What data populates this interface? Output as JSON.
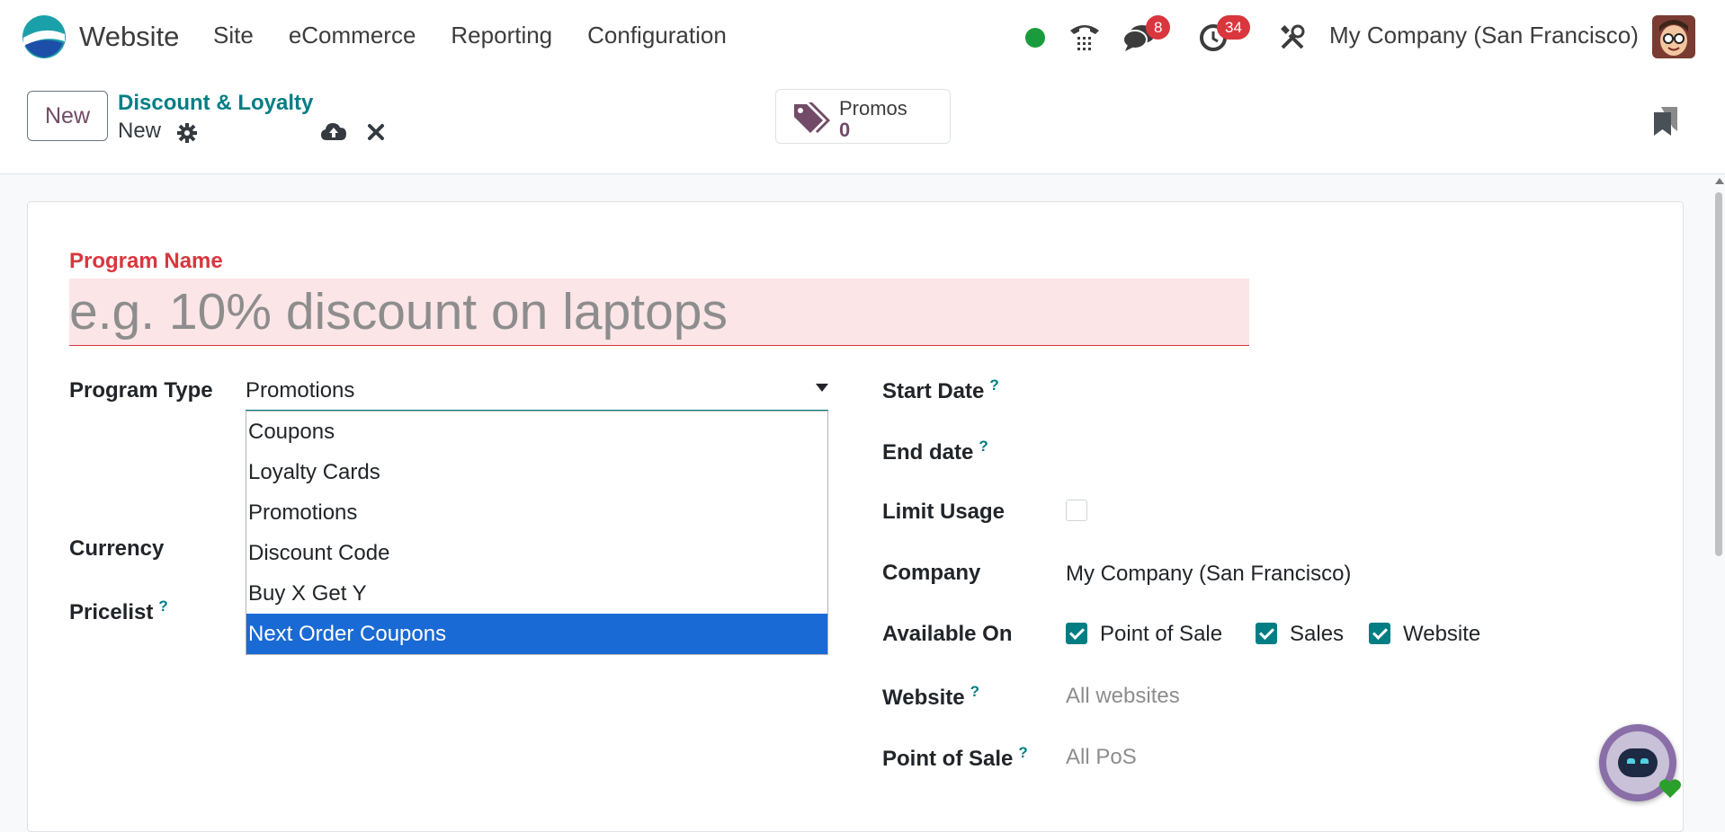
{
  "navbar": {
    "app_name": "Website",
    "menu": [
      "Site",
      "eCommerce",
      "Reporting",
      "Configuration"
    ],
    "messages_count": "8",
    "activities_count": "34",
    "company": "My Company (San Francisco)",
    "status_color": "#1a9c3e"
  },
  "control_panel": {
    "new_button": "New",
    "breadcrumb_parent": "Discount & Loyalty",
    "breadcrumb_current": "New",
    "stat_button": {
      "label": "Promos",
      "value": "0"
    }
  },
  "form": {
    "program_name_label": "Program Name",
    "program_name_placeholder": "e.g. 10% discount on laptops",
    "program_type_label": "Program Type",
    "program_type_value": "Promotions",
    "program_type_options": [
      "Coupons",
      "Loyalty Cards",
      "Promotions",
      "Discount Code",
      "Buy X Get Y",
      "Next Order Coupons"
    ],
    "program_type_highlighted": "Next Order Coupons",
    "currency_label": "Currency",
    "pricelist_label": "Pricelist",
    "start_date_label": "Start Date",
    "end_date_label": "End date",
    "limit_usage_label": "Limit Usage",
    "limit_usage_checked": false,
    "company_label": "Company",
    "company_value": "My Company (San Francisco)",
    "available_on_label": "Available On",
    "available_on": [
      {
        "label": "Point of Sale",
        "checked": true
      },
      {
        "label": "Sales",
        "checked": true
      },
      {
        "label": "Website",
        "checked": true
      }
    ],
    "website_label": "Website",
    "website_value": "All websites",
    "pos_label": "Point of Sale",
    "pos_value": "All PoS",
    "help_mark": "?"
  },
  "colors": {
    "accent": "#017e84",
    "brand": "#714b67",
    "required": "#d9363e",
    "selection": "#1a6ad6"
  }
}
